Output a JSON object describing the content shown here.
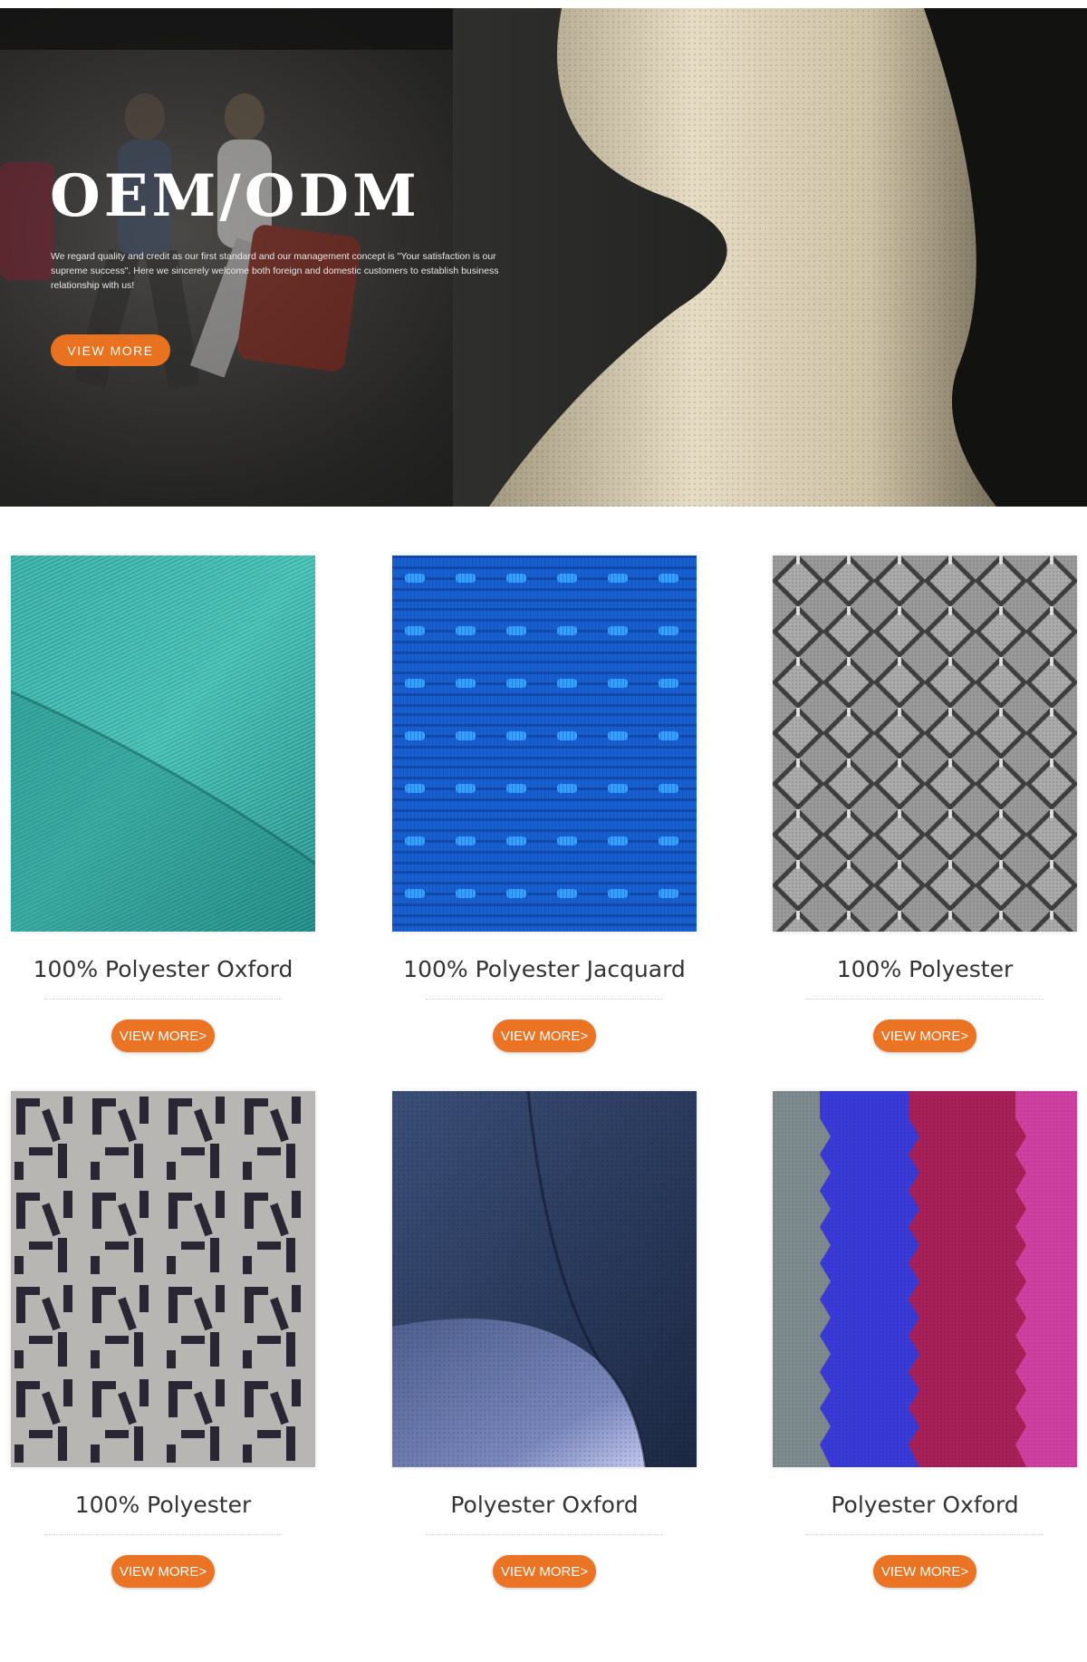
{
  "hero": {
    "title": "OEM/ODM",
    "description": "We regard quality and credit as our first standard and our management concept is \"Your satisfaction is our supreme success\". Here we sincerely welcome both foreign and domestic customers to establish business relationship with us!",
    "button_label": "VIEW MORE"
  },
  "products": [
    {
      "name": "100% Polyester Oxford",
      "button_label": "VIEW MORE>"
    },
    {
      "name": "100% Polyester Jacquard",
      "button_label": "VIEW MORE>"
    },
    {
      "name": "100% Polyester",
      "button_label": "VIEW MORE>"
    },
    {
      "name": "100% Polyester",
      "button_label": "VIEW MORE>"
    },
    {
      "name": "Polyester Oxford",
      "button_label": "VIEW MORE>"
    },
    {
      "name": "Polyester Oxford",
      "button_label": "VIEW MORE>"
    }
  ],
  "colors": {
    "accent": "#e8721f",
    "hero_bg": "#1b1b1a",
    "text": "#333333"
  }
}
